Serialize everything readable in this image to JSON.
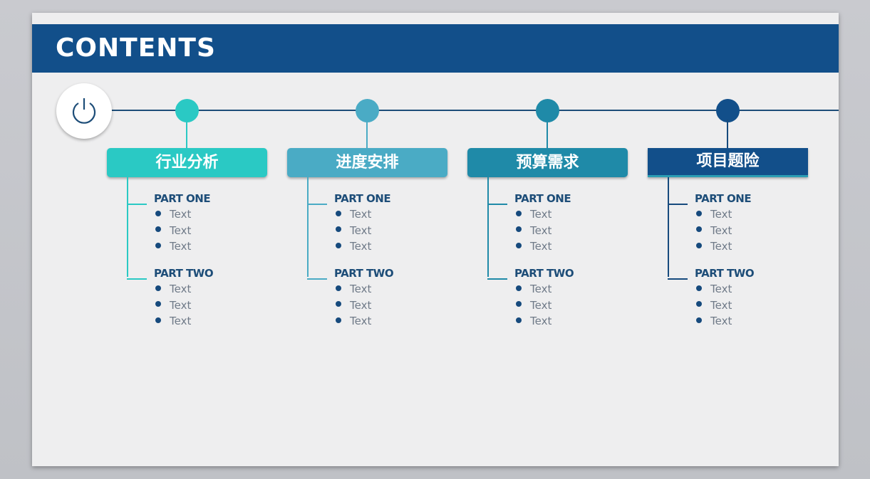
{
  "header": {
    "title": "CONTENTS"
  },
  "start_icon": "power-icon",
  "sections": [
    {
      "title": "行业分析",
      "color": "#2ac9c4",
      "line_color": "#2ac9c4",
      "parts": [
        {
          "label": "PART ONE",
          "items": [
            "Text",
            "Text",
            "Text"
          ]
        },
        {
          "label": "PART TWO",
          "items": [
            "Text",
            "Text",
            "Text"
          ]
        }
      ]
    },
    {
      "title": "进度安排",
      "color": "#4aabc5",
      "line_color": "#4aabc5",
      "parts": [
        {
          "label": "PART ONE",
          "items": [
            "Text",
            "Text",
            "Text"
          ]
        },
        {
          "label": "PART TWO",
          "items": [
            "Text",
            "Text",
            "Text"
          ]
        }
      ]
    },
    {
      "title": "预算需求",
      "color": "#1f8aa8",
      "line_color": "#1f8aa8",
      "parts": [
        {
          "label": "PART ONE",
          "items": [
            "Text",
            "Text",
            "Text"
          ]
        },
        {
          "label": "PART TWO",
          "items": [
            "Text",
            "Text",
            "Text"
          ]
        }
      ]
    },
    {
      "title": "项目题险",
      "color": "#124f8a",
      "line_color": "#164a7d",
      "parts": [
        {
          "label": "PART ONE",
          "items": [
            "Text",
            "Text",
            "Text"
          ]
        },
        {
          "label": "PART TWO",
          "items": [
            "Text",
            "Text",
            "Text"
          ]
        }
      ]
    }
  ]
}
